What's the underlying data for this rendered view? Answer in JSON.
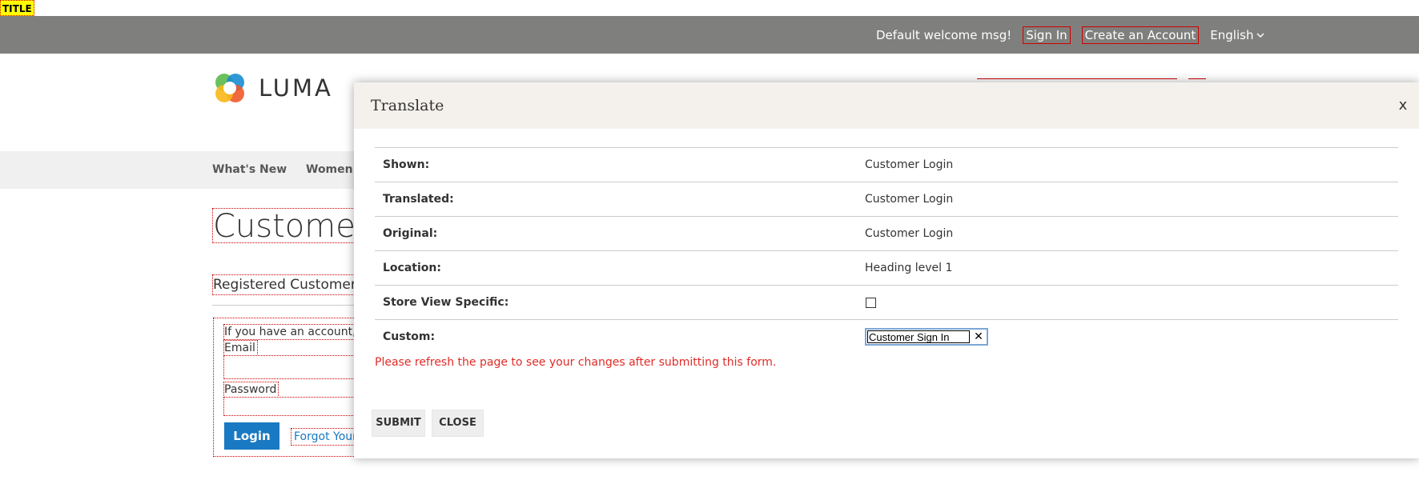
{
  "badge": {
    "label": "TITLE"
  },
  "header": {
    "welcome": "Default welcome msg!",
    "sign_in": "Sign In",
    "create_account": "Create an Account",
    "language": "English",
    "logo_text": "LUMA",
    "logo_icon": "luma-logo-icon",
    "language_icon": "chevron-down-icon"
  },
  "nav": {
    "items": [
      "What's New",
      "Women"
    ]
  },
  "page": {
    "title": "Customer Login",
    "section_title": "Registered Customers",
    "intro": "If you have an account, sign in with your email address.",
    "email_label": "Email",
    "password_label": "Password",
    "login_button": "Login",
    "forgot_link": "Forgot Your Password?"
  },
  "modal": {
    "title": "Translate",
    "close_x": "x",
    "rows": {
      "shown": {
        "label": "Shown:",
        "value": "Customer Login"
      },
      "translated": {
        "label": "Translated:",
        "value": "Customer Login"
      },
      "original": {
        "label": "Original:",
        "value": "Customer Login"
      },
      "location": {
        "label": "Location:",
        "value": "Heading level 1"
      },
      "store_view": {
        "label": "Store View Specific:",
        "checked": false
      },
      "custom": {
        "label": "Custom:",
        "value": "Customer Sign In",
        "clear": "✕"
      }
    },
    "note": "Please refresh the page to see your changes after submitting this form.",
    "submit": "SUBMIT",
    "close": "CLOSE"
  },
  "colors": {
    "topbar": "#7f807e",
    "nav": "#f0f0f0",
    "modal_header": "#f4f1ed",
    "primary_button": "#1979c3",
    "note_red": "#e02b27",
    "badge_yellow": "#ffff00"
  }
}
